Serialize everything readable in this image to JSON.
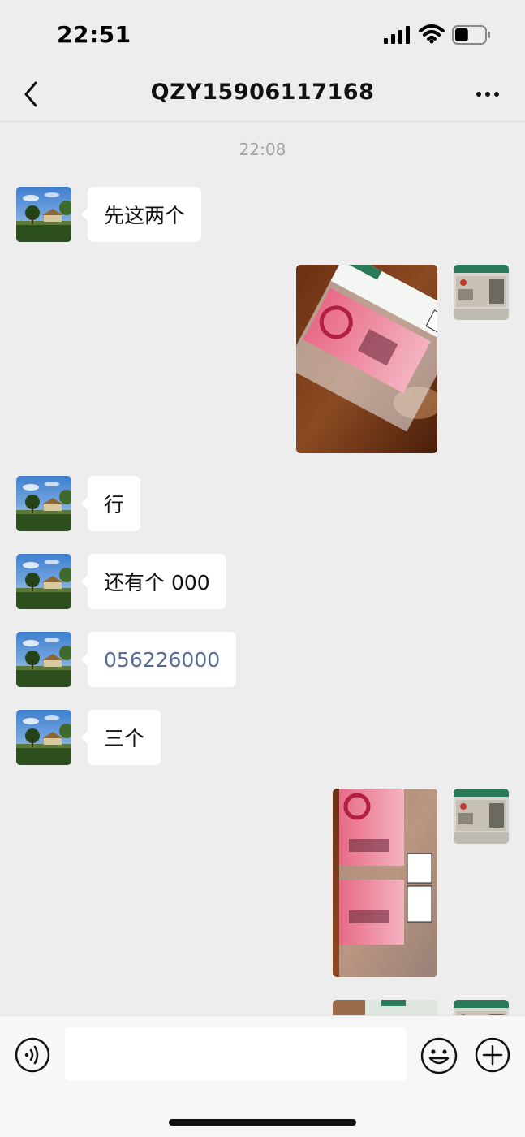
{
  "status_bar": {
    "time": "22:51",
    "battery_level": 0.45
  },
  "header": {
    "title": "QZY15906117168"
  },
  "chat": {
    "timestamp": "22:08",
    "messages": [
      {
        "side": "left",
        "type": "text",
        "text": "先这两个"
      },
      {
        "side": "right",
        "type": "image",
        "description_icon": "banknote-photo-1"
      },
      {
        "side": "left",
        "type": "text",
        "text": "行"
      },
      {
        "side": "left",
        "type": "text",
        "text": "还有个 000"
      },
      {
        "side": "left",
        "type": "link",
        "text": "056226000"
      },
      {
        "side": "left",
        "type": "text",
        "text": "三个"
      },
      {
        "side": "right",
        "type": "image",
        "description_icon": "banknote-photo-2"
      },
      {
        "side": "right",
        "type": "image",
        "description_icon": "banknote-photo-3"
      }
    ]
  },
  "input_bar": {
    "placeholder": "",
    "value": ""
  },
  "colors": {
    "background": "#ededed",
    "bubble": "#ffffff",
    "link": "#576b95",
    "timestamp": "#a3a3a3"
  }
}
